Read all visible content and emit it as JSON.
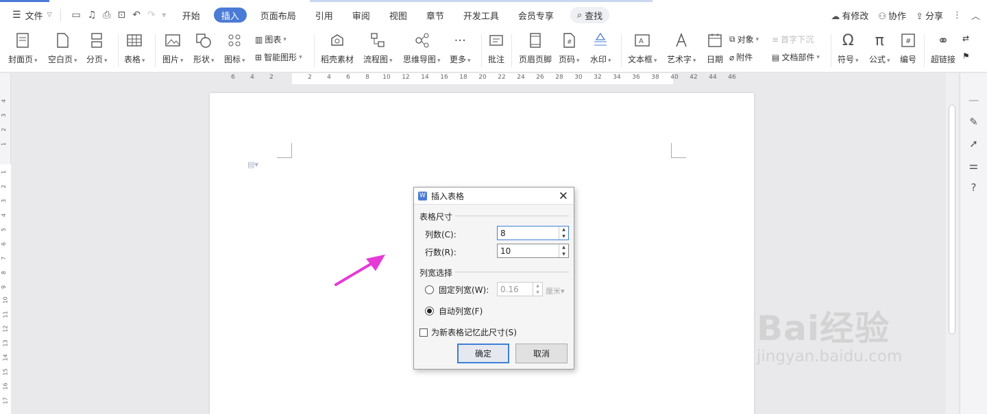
{
  "menubar": {
    "file": "文件",
    "tabs": [
      "开始",
      "插入",
      "页面布局",
      "引用",
      "审阅",
      "视图",
      "章节",
      "开发工具",
      "会员专享"
    ],
    "active_tab": "插入",
    "search": "查找",
    "right": {
      "changes": "有修改",
      "collab": "协作",
      "share": "分享"
    }
  },
  "ribbon": {
    "cover": "封面页",
    "blank": "空白页",
    "pagebreak": "分页",
    "table": "表格",
    "picture": "图片",
    "shape": "形状",
    "icon": "图标",
    "chart": "图表",
    "smartart": "智能图形",
    "docer": "稻壳素材",
    "flow": "流程图",
    "mindmap": "思维导图",
    "more": "更多",
    "comment": "批注",
    "header": "页眉页脚",
    "pagenum": "页码",
    "watermark": "水印",
    "textbox": "文本框",
    "wordart": "艺术字",
    "date": "日期",
    "object": "对象",
    "attachment": "附件",
    "dropcap": "首字下沉",
    "docpart": "文档部件",
    "symbol": "符号",
    "formula": "公式",
    "numbering": "编号",
    "hyperlink": "超链接"
  },
  "ruler": {
    "h_ticks": [
      "6",
      "4",
      "2",
      "2",
      "4",
      "6",
      "8",
      "10",
      "12",
      "14",
      "16",
      "18",
      "20",
      "22",
      "24",
      "26",
      "28",
      "30",
      "32",
      "34",
      "36",
      "38",
      "40",
      "42",
      "44",
      "46"
    ],
    "v_ticks": [
      "4",
      "3",
      "2",
      "1",
      "1",
      "2",
      "3",
      "4",
      "5",
      "6",
      "7",
      "8",
      "9",
      "10",
      "11",
      "12",
      "13",
      "14",
      "15",
      "16",
      "17"
    ]
  },
  "dialog": {
    "title": "插入表格",
    "group_size": "表格尺寸",
    "cols_label": "列数(C):",
    "cols_value": "8",
    "rows_label": "行数(R):",
    "rows_value": "10",
    "group_width": "列宽选择",
    "fixed_label": "固定列宽(W):",
    "fixed_value": "0.16",
    "fixed_unit": "厘米",
    "auto_label": "自动列宽(F)",
    "remember_label": "为新表格记忆此尺寸(S)",
    "ok": "确定",
    "cancel": "取消"
  },
  "watermark": {
    "brand": "Bai经验",
    "url": "jingyan.baidu.com"
  },
  "colors": {
    "accent": "#4a7bd6",
    "arrow": "#e63ad6"
  }
}
